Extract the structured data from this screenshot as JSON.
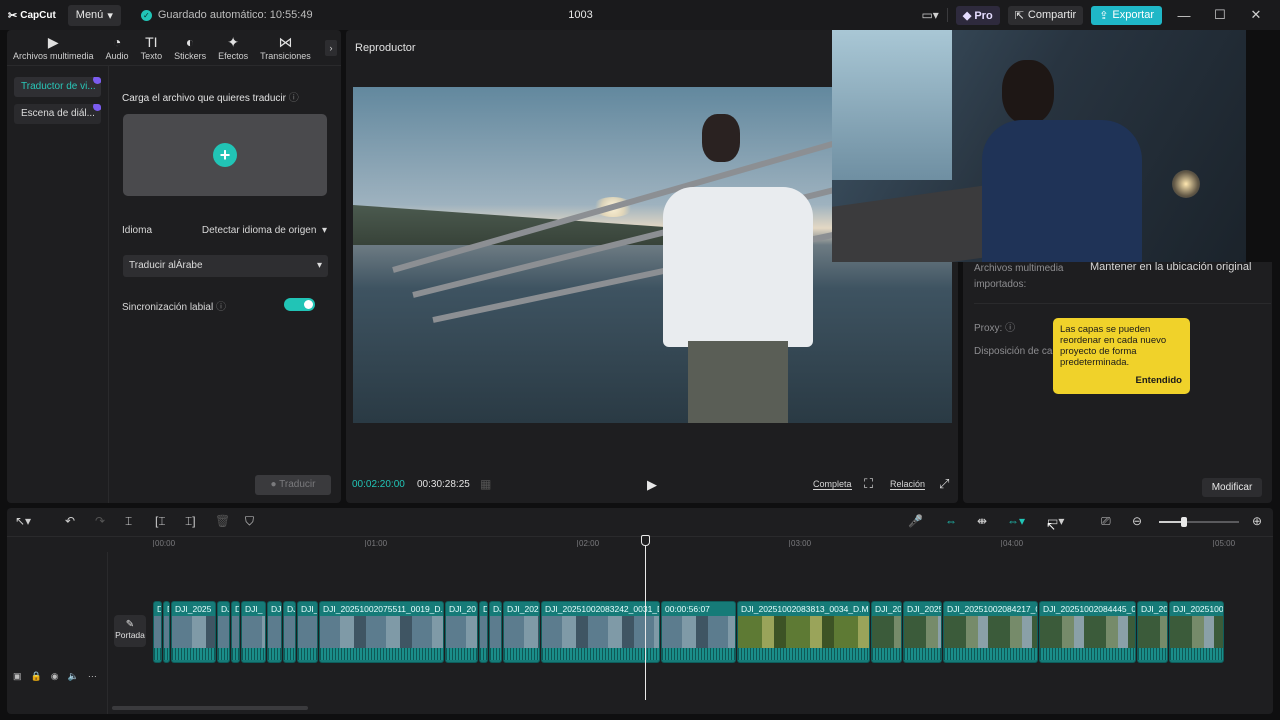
{
  "app": {
    "logo_text": "CapCut",
    "menu_label": "Menú",
    "autosave_text": "Guardado automático: 10:55:49",
    "project_name": "1003",
    "pro_label": "Pro",
    "share_label": "Compartir",
    "export_label": "Exportar"
  },
  "tool_tabs": [
    {
      "label": "Archivos multimedia",
      "icon": "media-icon"
    },
    {
      "label": "Audio",
      "icon": "audio-icon"
    },
    {
      "label": "Texto",
      "icon": "text-icon"
    },
    {
      "label": "Stickers",
      "icon": "sticker-icon"
    },
    {
      "label": "Efectos",
      "icon": "effects-icon"
    },
    {
      "label": "Transiciones",
      "icon": "transitions-icon"
    }
  ],
  "side_list": [
    {
      "label": "Traductor de vi...",
      "active": true
    },
    {
      "label": "Escena de diál...",
      "active": false
    }
  ],
  "translator": {
    "upload_title": "Carga el archivo que quieres traducir",
    "language_label": "Idioma",
    "language_value": "Detectar idioma de origen",
    "translate_to": "Traducir alÁrabe",
    "lipsync_label": "Sincronización labial",
    "lipsync_on": true,
    "translate_button": "Traducir"
  },
  "player": {
    "title": "Reproductor",
    "time_current": "00:02:20:00",
    "time_total": "00:30:28:25",
    "full_label": "Completa",
    "ratio_label": "Relación"
  },
  "properties": {
    "media_label": "Archivos multimedia importados:",
    "media_value": "Mantener en la ubicación original",
    "proxy_label": "Proxy:",
    "layout_label": "Disposición de ca",
    "modify_label": "Modificar"
  },
  "tooltip": {
    "text": "Las capas se pueden reordenar en cada nuevo proyecto de forma predeterminada.",
    "ok_label": "Entendido"
  },
  "timeline": {
    "ruler_ticks": [
      "00:00",
      "01:00",
      "02:00",
      "03:00",
      "04:00",
      "05:00"
    ],
    "cover_label": "Portada",
    "clips": [
      {
        "name": "D",
        "style": "water"
      },
      {
        "name": "D",
        "style": "water"
      },
      {
        "name": "DJI_2025",
        "style": "water"
      },
      {
        "name": "DJ",
        "style": "water"
      },
      {
        "name": "D",
        "style": "water"
      },
      {
        "name": "DJI_",
        "style": "water"
      },
      {
        "name": "DJI",
        "style": "water"
      },
      {
        "name": "DJ",
        "style": "water"
      },
      {
        "name": "DJI_",
        "style": "water"
      },
      {
        "name": "DJI_20251002075511_0019_D.M",
        "style": "water"
      },
      {
        "name": "DJI_20",
        "style": "water"
      },
      {
        "name": "D",
        "style": "water"
      },
      {
        "name": "DJ",
        "style": "water"
      },
      {
        "name": "DJI_202",
        "style": "water"
      },
      {
        "name": "DJI_20251002083242_0031_D.MP4",
        "style": "water"
      },
      {
        "name": "00:00:56:07",
        "style": "water"
      },
      {
        "name": "DJI_20251002083813_0034_D.MP",
        "style": "green"
      },
      {
        "name": "DJI_20",
        "style": "forest"
      },
      {
        "name": "DJI_2025",
        "style": "forest"
      },
      {
        "name": "DJI_20251002084217_0(",
        "style": "forest"
      },
      {
        "name": "DJI_20251002084445_0(",
        "style": "forest"
      },
      {
        "name": "DJI_20",
        "style": "forest"
      },
      {
        "name": "DJI_20251000",
        "style": "forest"
      }
    ]
  },
  "colors": {
    "accent": "#21c4b6",
    "export": "#1fb7c7",
    "tooltip": "#f0d22a",
    "clip": "#167b78"
  }
}
